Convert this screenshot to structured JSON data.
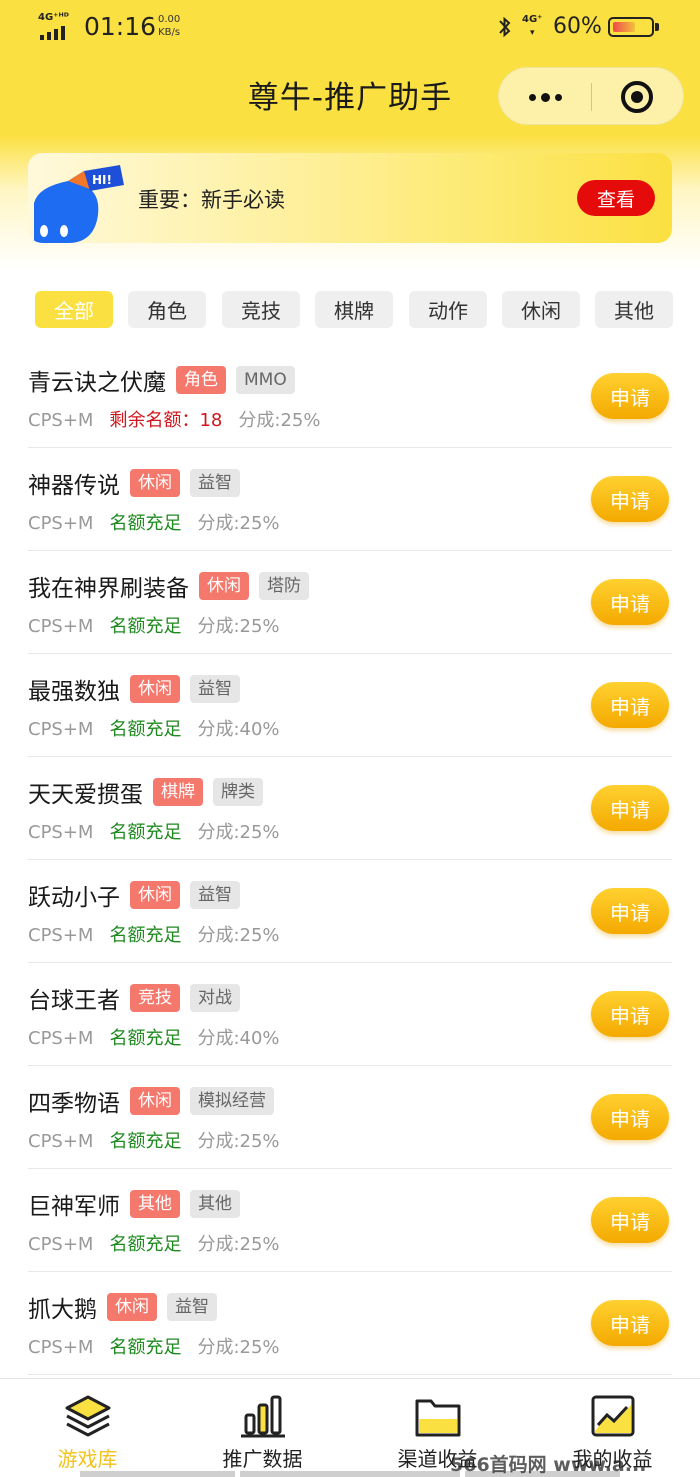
{
  "status_bar": {
    "network_left": "4G⁺ᴴᴰ",
    "time": "01:16",
    "speed_value": "0.00",
    "speed_unit": "KB/s",
    "network_right": "4G⁺",
    "battery_percent": "60%",
    "battery_level": 0.6
  },
  "header": {
    "title": "尊牛-推广助手",
    "capsule_icons": [
      "more-icon",
      "close-target-icon"
    ]
  },
  "notice": {
    "badge_text": "HI!",
    "text": "重要：新手必读",
    "button": "查看",
    "button_color": "#e60b0b"
  },
  "tabs": [
    {
      "label": "全部",
      "active": true
    },
    {
      "label": "角色",
      "active": false
    },
    {
      "label": "竞技",
      "active": false
    },
    {
      "label": "棋牌",
      "active": false
    },
    {
      "label": "动作",
      "active": false
    },
    {
      "label": "休闲",
      "active": false
    },
    {
      "label": "其他",
      "active": false
    }
  ],
  "games": [
    {
      "name": "青云诀之伏魔",
      "category": "角色",
      "subtag": "MMO",
      "mode": "CPS+M",
      "quota": "剩余名额：18",
      "quota_status": "low",
      "share": "分成:25%",
      "action": "申请"
    },
    {
      "name": "神器传说",
      "category": "休闲",
      "subtag": "益智",
      "mode": "CPS+M",
      "quota": "名额充足",
      "quota_status": "ok",
      "share": "分成:25%",
      "action": "申请"
    },
    {
      "name": "我在神界刷装备",
      "category": "休闲",
      "subtag": "塔防",
      "mode": "CPS+M",
      "quota": "名额充足",
      "quota_status": "ok",
      "share": "分成:25%",
      "action": "申请"
    },
    {
      "name": "最强数独",
      "category": "休闲",
      "subtag": "益智",
      "mode": "CPS+M",
      "quota": "名额充足",
      "quota_status": "ok",
      "share": "分成:40%",
      "action": "申请"
    },
    {
      "name": "天天爱掼蛋",
      "category": "棋牌",
      "subtag": "牌类",
      "mode": "CPS+M",
      "quota": "名额充足",
      "quota_status": "ok",
      "share": "分成:25%",
      "action": "申请"
    },
    {
      "name": "跃动小子",
      "category": "休闲",
      "subtag": "益智",
      "mode": "CPS+M",
      "quota": "名额充足",
      "quota_status": "ok",
      "share": "分成:25%",
      "action": "申请"
    },
    {
      "name": "台球王者",
      "category": "竞技",
      "subtag": "对战",
      "mode": "CPS+M",
      "quota": "名额充足",
      "quota_status": "ok",
      "share": "分成:40%",
      "action": "申请"
    },
    {
      "name": "四季物语",
      "category": "休闲",
      "subtag": "模拟经营",
      "mode": "CPS+M",
      "quota": "名额充足",
      "quota_status": "ok",
      "share": "分成:25%",
      "action": "申请"
    },
    {
      "name": "巨神军师",
      "category": "其他",
      "subtag": "其他",
      "mode": "CPS+M",
      "quota": "名额充足",
      "quota_status": "ok",
      "share": "分成:25%",
      "action": "申请"
    },
    {
      "name": "抓大鹅",
      "category": "休闲",
      "subtag": "益智",
      "mode": "CPS+M",
      "quota": "名额充足",
      "quota_status": "ok",
      "share": "分成:25%",
      "action": "申请"
    }
  ],
  "bottom_nav": [
    {
      "label": "游戏库",
      "icon": "layers-icon",
      "active": true
    },
    {
      "label": "推广数据",
      "icon": "bar-chart-icon",
      "active": false
    },
    {
      "label": "渠道收益",
      "icon": "folder-icon",
      "active": false
    },
    {
      "label": "我的收益",
      "icon": "trend-chart-icon",
      "active": false
    }
  ],
  "watermark": "566首码网 www.a..."
}
